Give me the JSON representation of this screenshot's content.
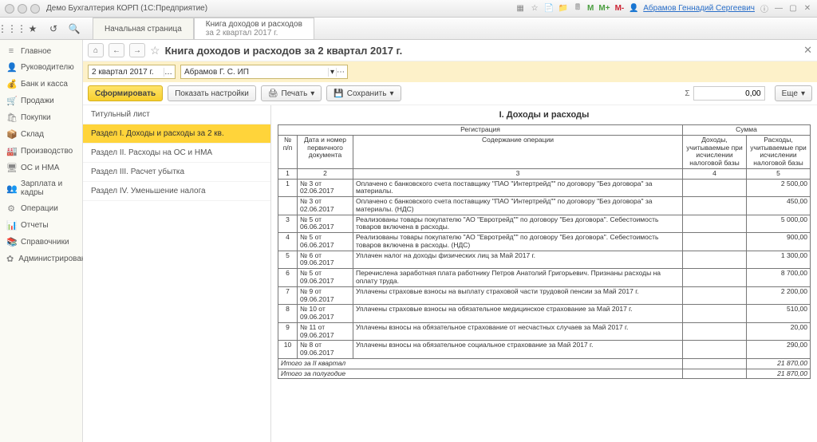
{
  "titlebar": {
    "app_title": "Демо Бухгалтерия КОРП (1С:Предприятие)",
    "user": "Абрамов Геннадий Сергеевич"
  },
  "tabs": {
    "home": "Начальная страница",
    "doc_line1": "Книга доходов и расходов",
    "doc_line2": "за 2 квартал 2017 г."
  },
  "sidebar": [
    {
      "icon": "≡",
      "label": "Главное"
    },
    {
      "icon": "👤",
      "label": "Руководителю"
    },
    {
      "icon": "💰",
      "label": "Банк и касса"
    },
    {
      "icon": "🛒",
      "label": "Продажи"
    },
    {
      "icon": "🛍",
      "label": "Покупки"
    },
    {
      "icon": "📦",
      "label": "Склад"
    },
    {
      "icon": "🏭",
      "label": "Производство"
    },
    {
      "icon": "🖥",
      "label": "ОС и НМА"
    },
    {
      "icon": "👥",
      "label": "Зарплата и кадры"
    },
    {
      "icon": "⚙",
      "label": "Операции"
    },
    {
      "icon": "📊",
      "label": "Отчеты"
    },
    {
      "icon": "📚",
      "label": "Справочники"
    },
    {
      "icon": "✿",
      "label": "Администрирование"
    }
  ],
  "header": {
    "title": "Книга доходов и расходов за 2 квартал 2017 г."
  },
  "filter": {
    "period": "2 квартал 2017 г.",
    "org": "Абрамов Г. С. ИП"
  },
  "actions": {
    "form": "Сформировать",
    "settings": "Показать настройки",
    "print": "Печать",
    "save": "Сохранить",
    "sum_label": "Σ",
    "sum": "0,00",
    "more": "Еще"
  },
  "sections": [
    "Титульный лист",
    "Раздел I. Доходы и расходы за 2 кв.",
    "Раздел II. Расходы на ОС и НМА",
    "Раздел III. Расчет убытка",
    "Раздел IV. Уменьшение налога"
  ],
  "report": {
    "title": "I. Доходы и расходы",
    "group1": "Регистрация",
    "group2": "Сумма",
    "col_n": "№ п/п",
    "col_doc": "Дата и номер первичного документа",
    "col_op": "Содержание операции",
    "col_inc": "Доходы, учитываемые при исчислении налоговой базы",
    "col_exp": "Расходы, учитываемые при исчислении налоговой базы",
    "h1": "1",
    "h2": "2",
    "h3": "3",
    "h4": "4",
    "h5": "5",
    "rows": [
      {
        "n": "1",
        "doc": "№ 3 от 02.06.2017",
        "op": "Оплачено с банковского счета поставщику \"ПАО \"Интертрейд\"\" по договору \"Без договора\" за материалы.",
        "inc": "",
        "exp": "2 500,00"
      },
      {
        "n": "",
        "doc": "№ 3 от 02.06.2017",
        "op": "Оплачено с банковского счета поставщику \"ПАО \"Интертрейд\"\" по договору \"Без договора\" за материалы. (НДС)",
        "inc": "",
        "exp": "450,00"
      },
      {
        "n": "3",
        "doc": "№ 5 от 06.06.2017",
        "op": "Реализованы товары покупателю \"АО \"Евротрейд\"\" по договору \"Без договора\". Себестоимость товаров включена в расходы.",
        "inc": "",
        "exp": "5 000,00"
      },
      {
        "n": "4",
        "doc": "№ 5 от 06.06.2017",
        "op": "Реализованы товары покупателю \"АО \"Евротрейд\"\" по договору \"Без договора\". Себестоимость товаров включена в расходы. (НДС)",
        "inc": "",
        "exp": "900,00"
      },
      {
        "n": "5",
        "doc": "№ 6 от 09.06.2017",
        "op": "Уплачен налог на доходы физических лиц за Май 2017 г.",
        "inc": "",
        "exp": "1 300,00"
      },
      {
        "n": "6",
        "doc": "№ 5 от 09.06.2017",
        "op": "Перечислена заработная плата работнику Петров Анатолий Григорьевич. Признаны расходы на оплату труда.",
        "inc": "",
        "exp": "8 700,00"
      },
      {
        "n": "7",
        "doc": "№ 9 от 09.06.2017",
        "op": "Уплачены страховые взносы на выплату страховой части трудовой пенсии за Май 2017 г.",
        "inc": "",
        "exp": "2 200,00"
      },
      {
        "n": "8",
        "doc": "№ 10 от 09.06.2017",
        "op": "Уплачены страховые взносы на обязательное медицинское страхование за Май 2017 г.",
        "inc": "",
        "exp": "510,00"
      },
      {
        "n": "9",
        "doc": "№ 11 от 09.06.2017",
        "op": "Уплачены взносы на обязательное страхование от несчастных случаев за Май 2017 г.",
        "inc": "",
        "exp": "20,00"
      },
      {
        "n": "10",
        "doc": "№ 8 от 09.06.2017",
        "op": "Уплачены взносы на обязательное социальное страхование за Май 2017 г.",
        "inc": "",
        "exp": "290,00"
      }
    ],
    "total_q": "Итого за II квартал",
    "total_q_val": "21 870,00",
    "total_h": "Итого за полугодие",
    "total_h_val": "21 870,00"
  }
}
